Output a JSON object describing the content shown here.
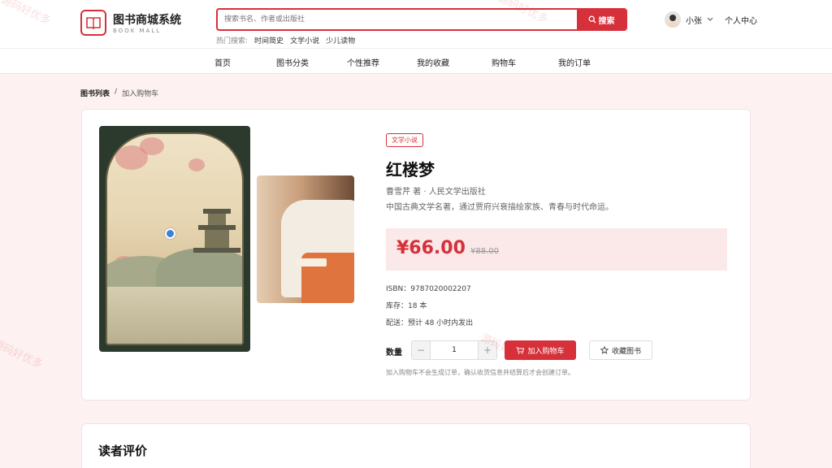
{
  "brand": {
    "title": "图书商城系统",
    "subtitle": "BOOK MALL"
  },
  "search": {
    "placeholder": "搜索书名、作者或出版社",
    "button": "搜索"
  },
  "hot": {
    "label": "热门搜索:",
    "tags": [
      "时间简史",
      "文学小说",
      "少儿读物"
    ]
  },
  "user": {
    "name": "小张",
    "center": "个人中心"
  },
  "nav": [
    "首页",
    "图书分类",
    "个性推荐",
    "我的收藏",
    "购物车",
    "我的订单"
  ],
  "breadcrumb": {
    "root": "图书列表",
    "sep": "/",
    "current": "加入购物车"
  },
  "book": {
    "category": "文学小说",
    "title": "红楼梦",
    "author_line": "曹雪芹 著 · 人民文学出版社",
    "desc": "中国古典文学名著，通过贾府兴衰描绘家族、青春与时代命运。",
    "price": "¥66.00",
    "old_price": "¥88.00",
    "isbn": "ISBN：9787020002207",
    "stock": "库存：18 本",
    "delivery": "配送：预计 48 小时内发出"
  },
  "purchase": {
    "qty_label": "数量",
    "qty": "1",
    "minus": "−",
    "plus": "+",
    "add_cart": "加入购物车",
    "favorite": "收藏图书",
    "hint": "加入购物车不会生成订单，确认收货信息并结算后才会创建订单。"
  },
  "reviews": {
    "title": "读者评价"
  },
  "watermark": "源码好优多",
  "colors": {
    "accent": "#d6303a",
    "bg": "#fdf1f1"
  }
}
